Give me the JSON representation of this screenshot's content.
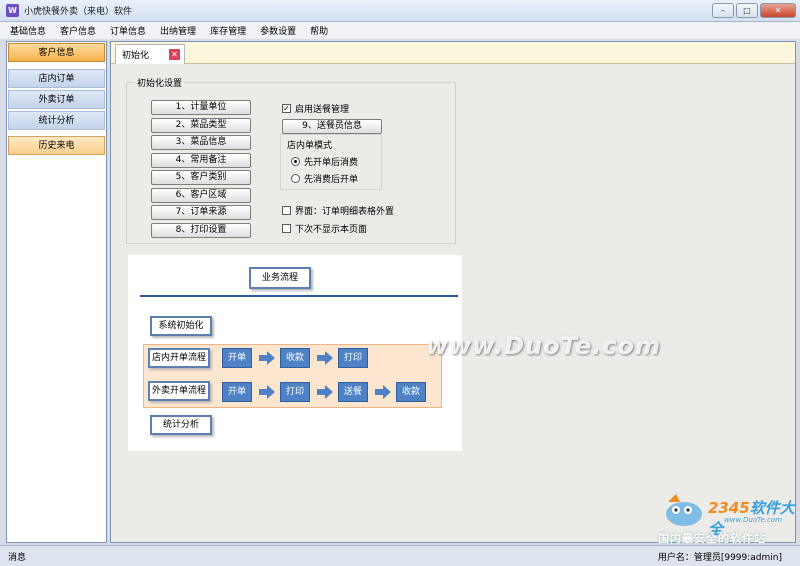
{
  "window": {
    "title": "小虎快餐外卖（来电）软件",
    "app_icon": "W",
    "min_glyph": "–",
    "max_glyph": "□",
    "close_glyph": "✕"
  },
  "menu": [
    "基础信息",
    "客户信息",
    "订单信息",
    "出纳管理",
    "库存管理",
    "参数设置",
    "帮助"
  ],
  "nav": {
    "items": [
      "客户信息",
      "店内订单",
      "外卖订单",
      "统计分析"
    ],
    "history": "历史来电"
  },
  "tab": {
    "label": "初始化",
    "close_glyph": "✕"
  },
  "init": {
    "group_title": "初始化设置",
    "buttons": [
      "1、计量单位",
      "2、菜品类型",
      "3、菜品信息",
      "4、常用备注",
      "5、客户类别",
      "6、客户区域",
      "7、订单来源",
      "8、打印设置"
    ],
    "enable_delivery": "启用送餐管理",
    "delivery_button": "9、送餐员信息",
    "mode_title": "店内单模式",
    "mode_options": [
      "先开单后消费",
      "先消费后开单"
    ],
    "option_table": "界面：订单明细表格外置",
    "option_hide": "下次不显示本页面"
  },
  "flow": {
    "title": "业务流程",
    "init": "系统初始化",
    "dinein": {
      "label": "店内开单流程",
      "steps": [
        "开单",
        "收款",
        "打印"
      ]
    },
    "takeout": {
      "label": "外卖开单流程",
      "steps": [
        "开单",
        "打印",
        "送餐",
        "收款"
      ]
    },
    "stats": "统计分析"
  },
  "watermark": "www.DuoTe.com",
  "logo": {
    "brand_a": "2345",
    "brand_b": "软件大全",
    "url": "www.DuoTe.com",
    "slogan": "国内最安全的软件站"
  },
  "status": {
    "left": "消息",
    "right": "用户名：管理员[9999:admin]"
  },
  "colors": {
    "accent": "#4f82c4",
    "flow_band": "#fde6cf",
    "active_nav": "#f5b14a",
    "tab_strip": "#fbf6dc"
  }
}
